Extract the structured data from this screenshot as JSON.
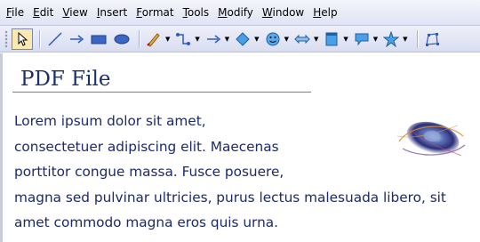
{
  "menubar": {
    "items": [
      {
        "key": "F",
        "rest": "ile"
      },
      {
        "key": "E",
        "rest": "dit"
      },
      {
        "key": "V",
        "rest": "iew"
      },
      {
        "key": "I",
        "rest": "nsert"
      },
      {
        "key": "F",
        "rest": "ormat"
      },
      {
        "key": "T",
        "rest": "ools"
      },
      {
        "key": "M",
        "rest": "odify"
      },
      {
        "key": "W",
        "rest": "indow"
      },
      {
        "key": "H",
        "rest": "elp"
      }
    ]
  },
  "toolbar": {
    "icons": [
      "select-icon",
      "line-icon",
      "arrow-icon",
      "rectangle-icon",
      "ellipse-icon",
      "freeform-icon",
      "connector-icon",
      "lines-arrows-icon",
      "basic-shapes-icon",
      "symbol-shapes-icon",
      "block-arrows-icon",
      "flowchart-icon",
      "callouts-icon",
      "stars-icon",
      "points-icon"
    ],
    "dropdown_glyph": "▼"
  },
  "document": {
    "title": "PDF File",
    "lines": [
      "Lorem ipsum dolor sit amet,",
      "consectetuer adipiscing elit. Maecenas",
      "porttitor congue massa. Fusce posuere,",
      "magna sed pulvinar ultricies, purus lectus malesuada libero, sit",
      "amet commodo magna eros quis urna."
    ]
  },
  "colors": {
    "title": "#1e2f6a",
    "body_text": "#1b2a6b",
    "accent": "#3a67c6"
  }
}
